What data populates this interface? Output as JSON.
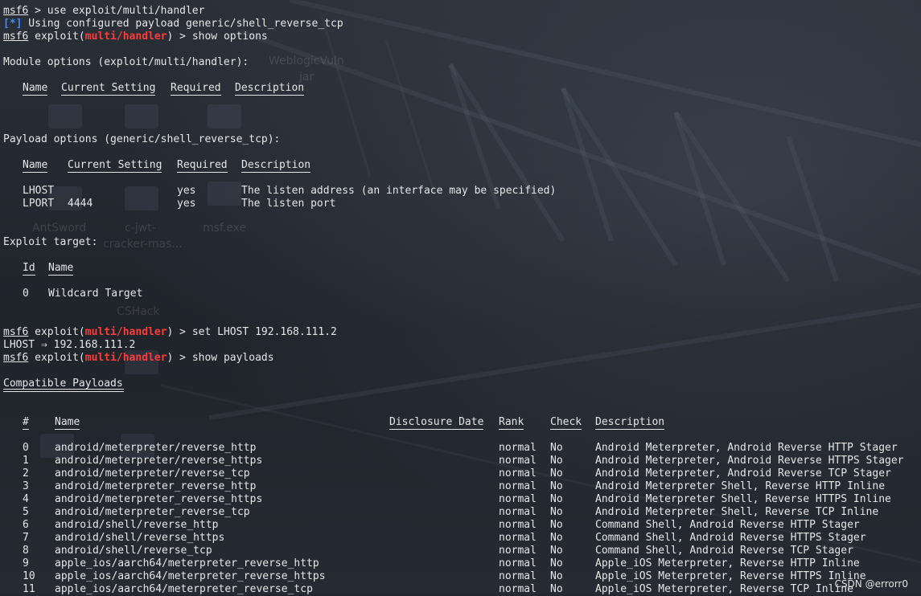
{
  "prompt": "msf6",
  "lines": {
    "l1_cmd": " > use exploit/multi/handler",
    "l2_tag": "[*]",
    "l2_text": " Using configured payload generic/shell_reverse_tcp",
    "l3_pre": " exploit(",
    "module": "multi/handler",
    "l3_post": ") > show options",
    "module_options": "Module options (exploit/multi/handler):",
    "payload_options": "Payload options (generic/shell_reverse_tcp):",
    "exploit_target": "Exploit target:",
    "set_cmd": ") > set LHOST 192.168.111.2",
    "set_result": "LHOST ⇒ 192.168.111.2",
    "show_payloads_cmd": ") > show payloads",
    "compatible_payloads": "Compatible Payloads"
  },
  "module_table": {
    "headers": [
      "Name",
      "Current Setting",
      "Required",
      "Description"
    ]
  },
  "payload_table": {
    "headers": [
      "Name",
      "Current Setting",
      "Required",
      "Description"
    ],
    "rows": [
      [
        "LHOST",
        "",
        "yes",
        "The listen address (an interface may be specified)"
      ],
      [
        "LPORT",
        "4444",
        "yes",
        "The listen port"
      ]
    ]
  },
  "target_table": {
    "headers": [
      "Id",
      "Name"
    ],
    "rows": [
      [
        "0",
        "Wildcard Target"
      ]
    ]
  },
  "payloads_table": {
    "headers": [
      "#",
      "Name",
      "Disclosure Date",
      "Rank",
      "Check",
      "Description"
    ],
    "rows": [
      [
        "0",
        "android/meterpreter/reverse_http",
        "",
        "normal",
        "No",
        "Android Meterpreter, Android Reverse HTTP Stager"
      ],
      [
        "1",
        "android/meterpreter/reverse_https",
        "",
        "normal",
        "No",
        "Android Meterpreter, Android Reverse HTTPS Stager"
      ],
      [
        "2",
        "android/meterpreter/reverse_tcp",
        "",
        "normal",
        "No",
        "Android Meterpreter, Android Reverse TCP Stager"
      ],
      [
        "3",
        "android/meterpreter_reverse_http",
        "",
        "normal",
        "No",
        "Android Meterpreter Shell, Reverse HTTP Inline"
      ],
      [
        "4",
        "android/meterpreter_reverse_https",
        "",
        "normal",
        "No",
        "Android Meterpreter Shell, Reverse HTTPS Inline"
      ],
      [
        "5",
        "android/meterpreter_reverse_tcp",
        "",
        "normal",
        "No",
        "Android Meterpreter Shell, Reverse TCP Inline"
      ],
      [
        "6",
        "android/shell/reverse_http",
        "",
        "normal",
        "No",
        "Command Shell, Android Reverse HTTP Stager"
      ],
      [
        "7",
        "android/shell/reverse_https",
        "",
        "normal",
        "No",
        "Command Shell, Android Reverse HTTPS Stager"
      ],
      [
        "8",
        "android/shell/reverse_tcp",
        "",
        "normal",
        "No",
        "Command Shell, Android Reverse TCP Stager"
      ],
      [
        "9",
        "apple_ios/aarch64/meterpreter_reverse_http",
        "",
        "normal",
        "No",
        "Apple_iOS Meterpreter, Reverse HTTP Inline"
      ],
      [
        "10",
        "apple_ios/aarch64/meterpreter_reverse_https",
        "",
        "normal",
        "No",
        "Apple_iOS Meterpreter, Reverse HTTPS Inline"
      ],
      [
        "11",
        "apple_ios/aarch64/meterpreter_reverse_tcp",
        "",
        "normal",
        "No",
        "Apple_iOS Meterpreter, Reverse TCP Inline"
      ]
    ]
  },
  "desktop_ghosts": [
    "WeblogicVuln",
    "jar",
    "AntSword",
    "c-jwt-",
    "cracker-mas...",
    "msf.exe",
    "CSHack"
  ],
  "watermark": "CSDN @errorr0",
  "colors": {
    "background": "#22262e",
    "text": "#e6e6e6",
    "module": "#ff3b3b",
    "info_tag": "#3a8cff"
  }
}
